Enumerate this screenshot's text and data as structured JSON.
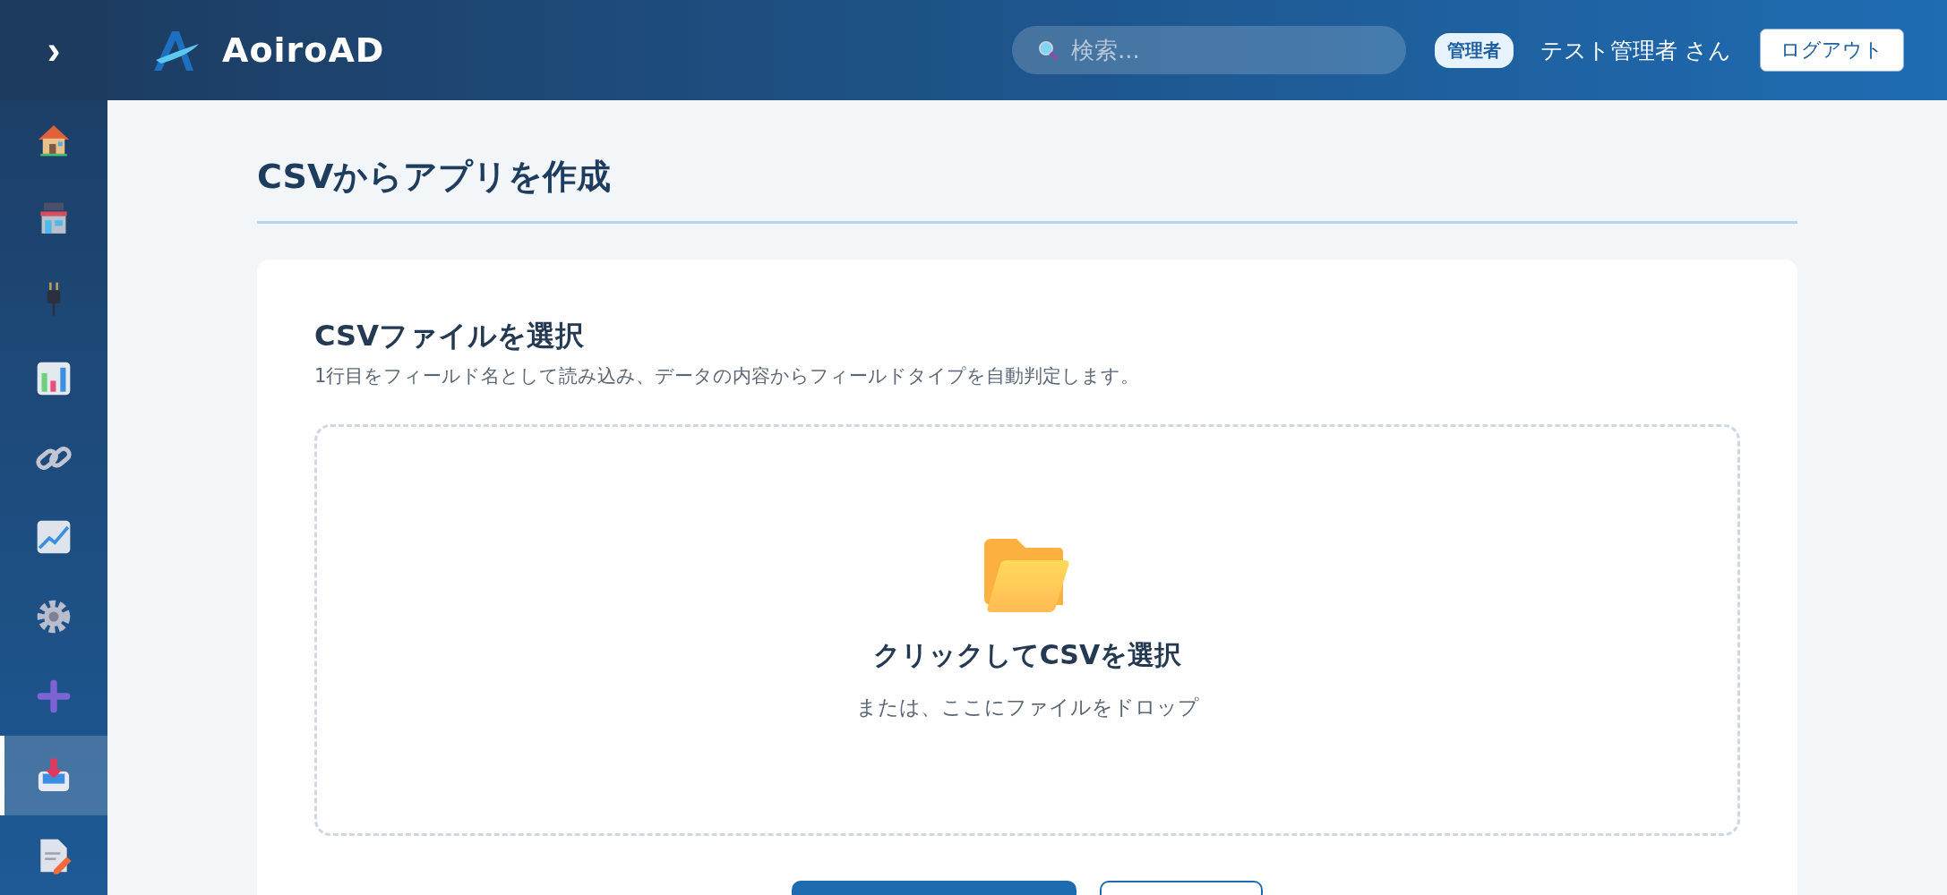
{
  "header": {
    "logo_text": "AoiroAD",
    "search": {
      "placeholder": "検索..."
    },
    "role_badge": "管理者",
    "user_name": "テスト管理者 さん",
    "logout": "ログアウト"
  },
  "sidebar": {
    "toggle": "›",
    "items": [
      {
        "selected": false
      },
      {
        "selected": false
      },
      {
        "selected": false
      },
      {
        "selected": false
      },
      {
        "selected": false
      },
      {
        "selected": false
      },
      {
        "selected": false
      },
      {
        "selected": false
      },
      {
        "selected": true
      },
      {
        "selected": false
      }
    ]
  },
  "page": {
    "title": "CSVからアプリを作成"
  },
  "card": {
    "title": "CSVファイルを選択",
    "description": "1行目をフィールド名として読み込み、データの内容からフィールドタイプを自動判定します。",
    "dropzone": {
      "title": "クリックしてCSVを選択",
      "hint": "または、ここにファイルをドロップ"
    },
    "actions": [
      {
        "kind": "primary"
      },
      {
        "kind": "secondary"
      }
    ]
  }
}
